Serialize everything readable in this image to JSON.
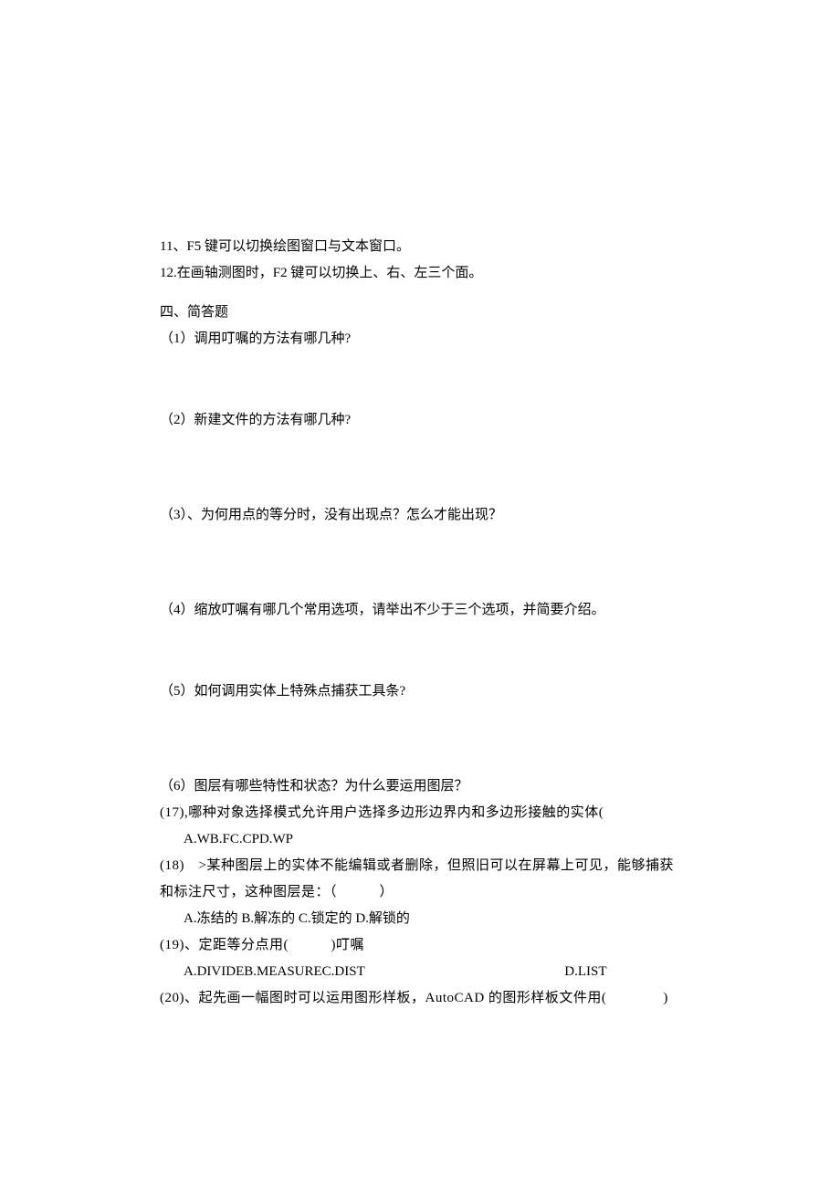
{
  "lines": {
    "l11": "11、F5 键可以切换绘图窗口与文本窗口。",
    "l12": "12.在画轴测图时，F2 键可以切换上、右、左三个面。",
    "sec4_title": "四、简答题",
    "q1": "（1）调用叮嘱的方法有哪几种?",
    "q2": "（2）新建文件的方法有哪几种?",
    "q3": "（3）、为何用点的等分时，没有出现点？怎么才能出现？",
    "q4": "（4）缩放叮嘱有哪几个常用选项，请举出不少于三个选项，并简要介绍。",
    "q5": "（5）如何调用实体上特殊点捕获工具条?",
    "q6": "（6）图层有哪些特性和状态？为什么要运用图层？",
    "q17_a": "(17),哪种对象选择模式允许用户选择多边形边界内和多边形接触的实体(",
    "q17_opt": "A.WB.FC.CPD.WP",
    "q18_a": "(18) >某种图层上的实体不能编辑或者删除，但照旧可以在屏幕上可见，能够捕获",
    "q18_b": "和标注尺寸，这种图层是：（   ）",
    "q18_opt": "A.冻结的 B.解冻的 C.锁定的 D.解锁的",
    "q19_a": "(19)、定距等分点用(   )叮嘱",
    "q19_opt_abc": "A.DIVIDEB.MEASUREC.DIST",
    "q19_opt_d": "D.LIST",
    "q20": "(20)、起先画一幅图时可以运用图形样板，AutoCAD 的图形样板文件用(    )"
  }
}
